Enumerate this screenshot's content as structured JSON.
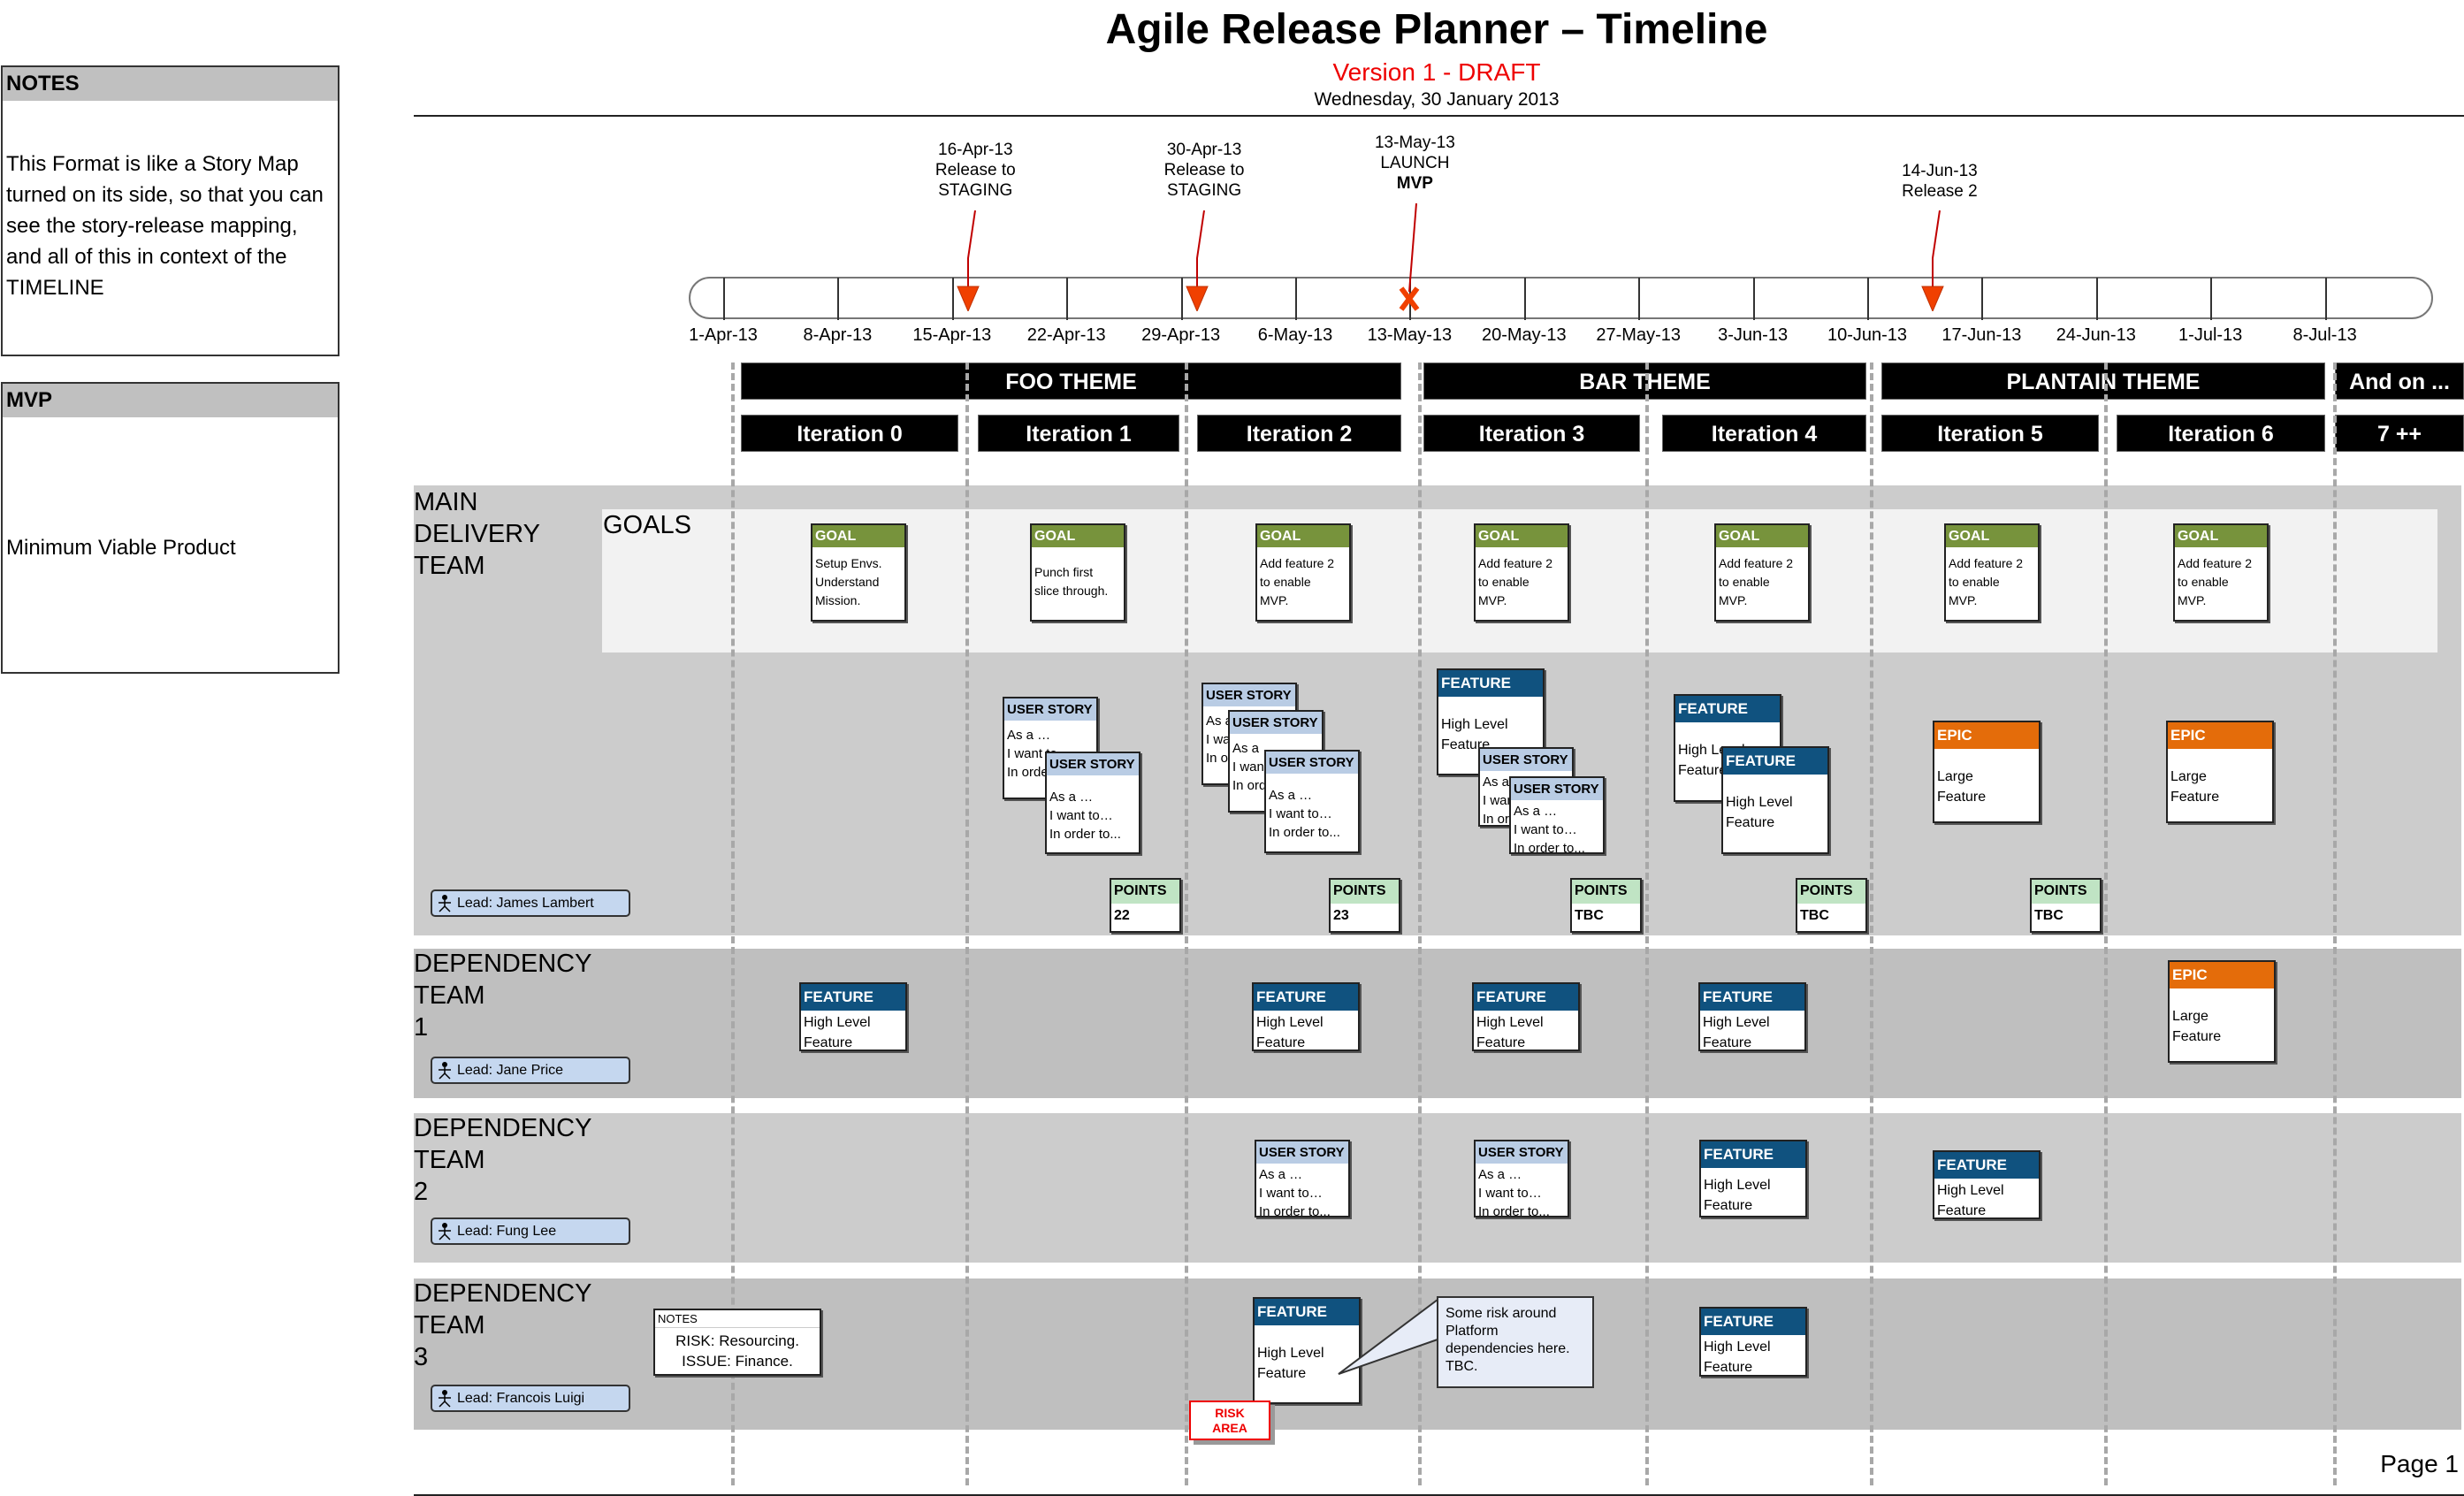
{
  "header": {
    "title": "Agile Release Planner – Timeline",
    "version": "Version 1 - DRAFT",
    "date": "Wednesday, 30 January 2013"
  },
  "side_panels": {
    "notes": {
      "title": "NOTES",
      "lines": [
        "This Format is like a Story Map",
        "turned on its side, so that you can",
        "see the story-release mapping,",
        "and all of this in context of the",
        "TIMELINE"
      ]
    },
    "mvp": {
      "title": "MVP",
      "text": "Minimum Viable Product"
    }
  },
  "timeline": {
    "ticks": [
      "1-Apr-13",
      "8-Apr-13",
      "15-Apr-13",
      "22-Apr-13",
      "29-Apr-13",
      "6-May-13",
      "13-May-13",
      "20-May-13",
      "27-May-13",
      "3-Jun-13",
      "10-Jun-13",
      "17-Jun-13",
      "24-Jun-13",
      "1-Jul-13",
      "8-Jul-13"
    ],
    "milestones": [
      {
        "date": "16-Apr-13",
        "line1": "Release to",
        "line2": "STAGING",
        "marker": "triangle"
      },
      {
        "date": "30-Apr-13",
        "line1": "Release to",
        "line2": "STAGING",
        "marker": "triangle"
      },
      {
        "date": "13-May-13",
        "line1": "LAUNCH",
        "line2": "MVP",
        "marker": "cross"
      },
      {
        "date": "14-Jun-13",
        "line1": "Release 2",
        "line2": "",
        "marker": "triangle"
      }
    ],
    "marker_color": "#f04000"
  },
  "themes": [
    "FOO THEME",
    "BAR THEME",
    "PLANTAIN THEME",
    "And on ..."
  ],
  "iterations": [
    "Iteration 0",
    "Iteration 1",
    "Iteration 2",
    "Iteration 3",
    "Iteration 4",
    "Iteration 5",
    "Iteration 6",
    "7 ++"
  ],
  "colors": {
    "goal": "#77933c",
    "feature": "#10527f",
    "user_story": "#b9cce4",
    "epic": "#e46c0a",
    "points": "#c0e4c4",
    "lead_badge": "#c5d7ef",
    "risk": "#ee0000"
  },
  "lanes": {
    "main": {
      "label": [
        "MAIN",
        "DELIVERY",
        "TEAM"
      ],
      "goals_label": "GOALS",
      "lead": "Lead: James Lambert",
      "goals": [
        {
          "title": "GOAL",
          "lines": [
            "Setup Envs.",
            "Understand",
            "Mission."
          ]
        },
        {
          "title": "GOAL",
          "lines": [
            "Punch first",
            "slice through."
          ]
        },
        {
          "title": "GOAL",
          "lines": [
            "Add feature 2",
            "to enable",
            "MVP."
          ]
        },
        {
          "title": "GOAL",
          "lines": [
            "Add feature 2",
            "to enable",
            "MVP."
          ]
        },
        {
          "title": "GOAL",
          "lines": [
            "Add feature 2",
            "to enable",
            "MVP."
          ]
        },
        {
          "title": "GOAL",
          "lines": [
            "Add feature 2",
            "to enable",
            "MVP."
          ]
        },
        {
          "title": "GOAL",
          "lines": [
            "Add feature 2",
            "to enable",
            "MVP."
          ]
        }
      ],
      "story": {
        "title": "USER STORY",
        "lines": [
          "As a …",
          "I want to…",
          "In order to..."
        ]
      },
      "feature": {
        "title": "FEATURE",
        "lines": [
          "High Level",
          "Feature"
        ]
      },
      "epic": {
        "title": "EPIC",
        "lines": [
          "Large",
          "Feature"
        ]
      },
      "points": [
        {
          "title": "POINTS",
          "value": "22"
        },
        {
          "title": "POINTS",
          "value": "23"
        },
        {
          "title": "POINTS",
          "value": "TBC"
        },
        {
          "title": "POINTS",
          "value": "TBC"
        },
        {
          "title": "POINTS",
          "value": "TBC"
        }
      ]
    },
    "dep1": {
      "label": [
        "DEPENDENCY",
        "TEAM",
        "1"
      ],
      "lead": "Lead: Jane Price"
    },
    "dep2": {
      "label": [
        "DEPENDENCY",
        "TEAM",
        "2"
      ],
      "lead": "Lead: Fung Lee"
    },
    "dep3": {
      "label": [
        "DEPENDENCY",
        "TEAM",
        "3"
      ],
      "lead": "Lead: Francois Luigi",
      "notes": {
        "title": "NOTES",
        "lines": [
          "RISK: Resourcing.",
          "ISSUE: Finance."
        ]
      },
      "callout": [
        "Some risk around",
        "Platform",
        "dependencies here.",
        "TBC."
      ],
      "risk": [
        "RISK",
        "AREA"
      ]
    }
  },
  "footer": {
    "page": "Page 1"
  }
}
